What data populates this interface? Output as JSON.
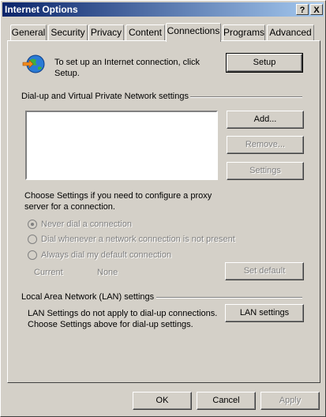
{
  "window": {
    "title": "Internet Options",
    "help_button": "?",
    "close_button": "X"
  },
  "tabs": [
    {
      "label": "General"
    },
    {
      "label": "Security"
    },
    {
      "label": "Privacy"
    },
    {
      "label": "Content"
    },
    {
      "label": "Connections",
      "active": true
    },
    {
      "label": "Programs"
    },
    {
      "label": "Advanced"
    }
  ],
  "setup": {
    "text_line1": "To set up an Internet connection, click",
    "text_line2": "Setup.",
    "button": "Setup"
  },
  "dialup": {
    "group_label": "Dial-up and Virtual Private Network settings",
    "add_button": "Add...",
    "remove_button": "Remove...",
    "settings_button": "Settings",
    "proxy_text_line1": "Choose Settings if you need to configure a proxy",
    "proxy_text_line2": "server for a connection.",
    "options": [
      {
        "label": "Never dial a connection",
        "checked": true
      },
      {
        "label": "Dial whenever a network connection is not present",
        "checked": false
      },
      {
        "label": "Always dial my default connection",
        "checked": false
      }
    ],
    "current_label": "Current",
    "current_value": "None",
    "set_default_button": "Set default"
  },
  "lan": {
    "group_label": "Local Area Network (LAN) settings",
    "text_line1": "LAN Settings do not apply to dial-up connections.",
    "text_line2": "Choose Settings above for dial-up settings.",
    "button": "LAN settings"
  },
  "footer": {
    "ok": "OK",
    "cancel": "Cancel",
    "apply": "Apply"
  },
  "icons": {
    "setup": "globe-arrow-icon"
  }
}
